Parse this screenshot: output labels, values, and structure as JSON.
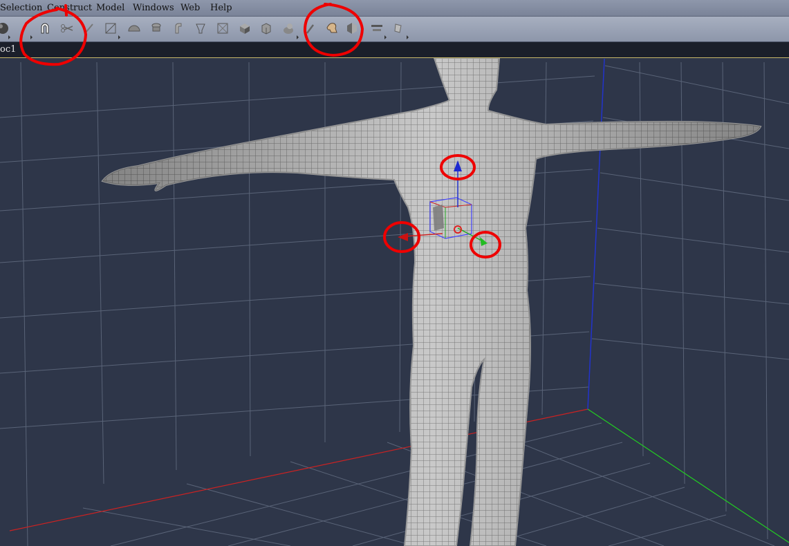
{
  "menubar": {
    "items": [
      "Selection",
      "Construct",
      "Model",
      "Windows",
      "Web",
      "Help"
    ]
  },
  "toolbar": {
    "tools": [
      {
        "icon": "sphere-icon"
      },
      {
        "icon": "magnet-icon"
      },
      {
        "icon": "scissors-icon"
      },
      {
        "icon": "knife-icon"
      },
      {
        "icon": "fit-box-icon"
      },
      {
        "icon": "dome-icon"
      },
      {
        "icon": "sweep-icon"
      },
      {
        "icon": "bend-icon"
      },
      {
        "icon": "taper-icon"
      },
      {
        "icon": "box-frame-icon"
      },
      {
        "icon": "cube-icon"
      },
      {
        "icon": "box-cut-icon"
      },
      {
        "icon": "pose-head-icon"
      },
      {
        "icon": "paintbrush-icon"
      },
      {
        "icon": "skin-shaper-icon"
      },
      {
        "icon": "half-mold-icon"
      },
      {
        "icon": "align-icon"
      },
      {
        "icon": "morph-icon"
      }
    ]
  },
  "document": {
    "tab_label": "oc1"
  },
  "viewport": {
    "background": "#2e3649",
    "grid_color": "#5a6478",
    "x_axis_color": "#cc2222",
    "y_axis_color": "#2233cc",
    "z_axis_color": "#22cc22",
    "model_color": "#d8d8d8",
    "annotation_color": "#ee0000"
  }
}
